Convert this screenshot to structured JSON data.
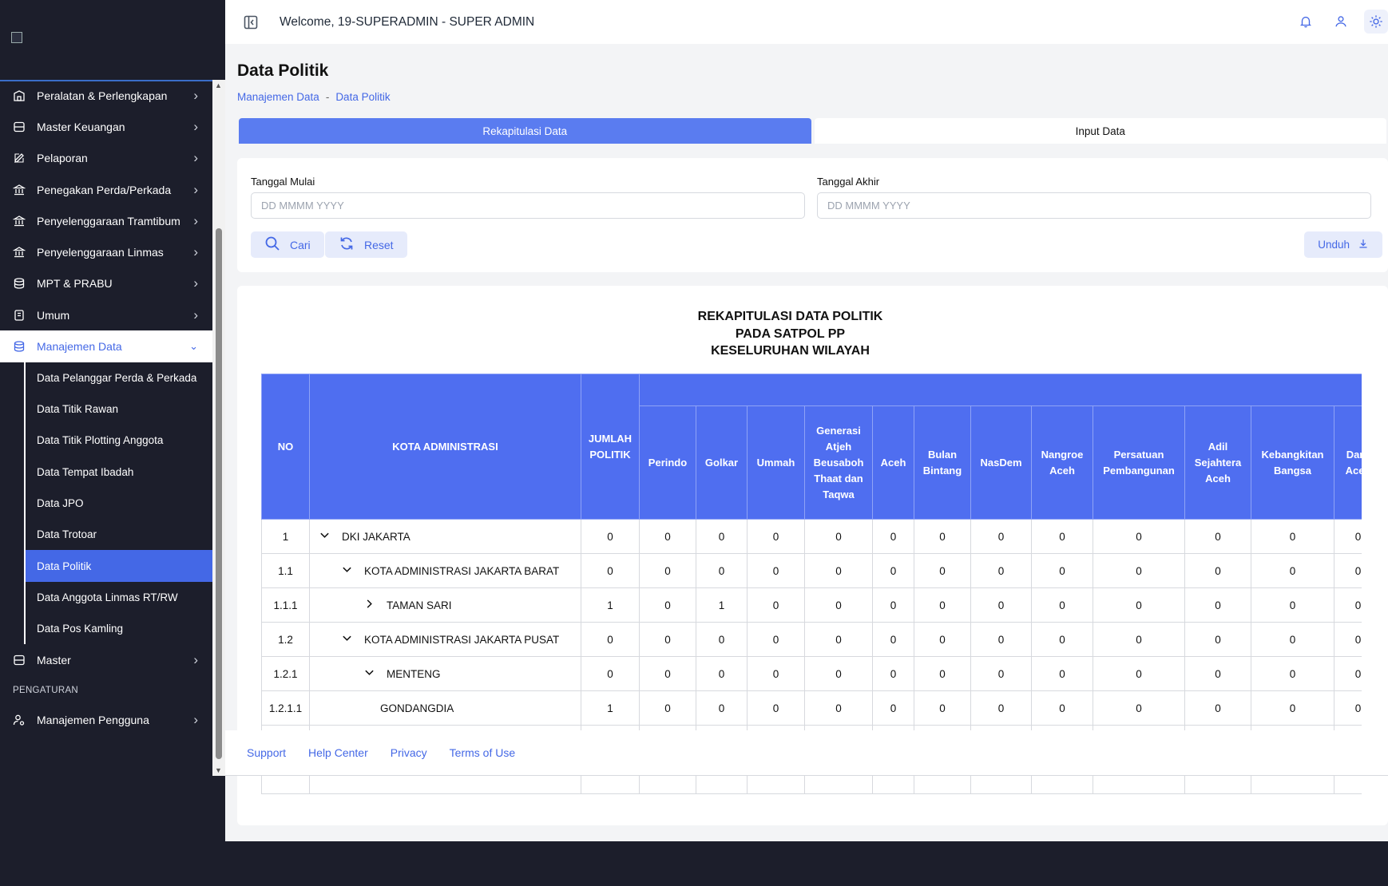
{
  "header": {
    "welcome": "Welcome, 19-SUPERADMIN - SUPER ADMIN",
    "icons": [
      "sidebar-toggle-icon",
      "bell-icon",
      "user-icon",
      "sun-icon"
    ]
  },
  "sidebar": {
    "items": [
      {
        "label": "Peralatan & Perlengkapan",
        "icon": "building-icon"
      },
      {
        "label": "Master Keuangan",
        "icon": "database-icon"
      },
      {
        "label": "Pelaporan",
        "icon": "edit-icon"
      },
      {
        "label": "Penegakan Perda/Perkada",
        "icon": "bank-icon"
      },
      {
        "label": "Penyelenggaraan Tramtibum",
        "icon": "bank-icon"
      },
      {
        "label": "Penyelenggaraan Linmas",
        "icon": "bank-icon"
      },
      {
        "label": "MPT & PRABU",
        "icon": "stack-icon"
      },
      {
        "label": "Umum",
        "icon": "book-icon"
      },
      {
        "label": "Manajemen Data",
        "icon": "stack-icon"
      }
    ],
    "subitems": [
      "Data Pelanggar Perda & Perkada",
      "Data Titik Rawan",
      "Data Titik Plotting Anggota",
      "Data Tempat Ibadah",
      "Data JPO",
      "Data Trotoar",
      "Data Politik",
      "Data Anggota Linmas RT/RW",
      "Data Pos Kamling"
    ],
    "after": {
      "label": "Master",
      "icon": "database-icon"
    },
    "section": "PENGATURAN",
    "settings": {
      "label": "Manajemen Pengguna",
      "icon": "user-cog-icon"
    }
  },
  "page": {
    "title": "Data Politik",
    "breadcrumb": [
      "Manajemen Data",
      "Data Politik"
    ],
    "breadcrumb_sep": "-"
  },
  "tabs": [
    "Rekapitulasi Data",
    "Input Data"
  ],
  "filter": {
    "start_label": "Tanggal Mulai",
    "start_placeholder": "DD MMMM YYYY",
    "end_label": "Tanggal Akhir",
    "end_placeholder": "DD MMMM YYYY",
    "search_btn": "Cari",
    "reset_btn": "Reset",
    "download_btn": "Unduh"
  },
  "report": {
    "title_lines": [
      "REKAPITULASI DATA POLITIK",
      "PADA SATPOL PP",
      "KESELURUHAN WILAYAH"
    ],
    "columns": {
      "no": "NO",
      "kota": "KOTA ADMINISTRASI",
      "jumlah": "JUMLAH POLITIK",
      "parties": [
        "Perindo",
        "Golkar",
        "Ummah",
        "Generasi Atjeh Beusaboh Thaat dan Taqwa",
        "Aceh",
        "Bulan Bintang",
        "NasDem",
        "Nangroe Aceh",
        "Persatuan Pembangunan",
        "Adil Sejahtera Aceh",
        "Kebangkitan Bangsa",
        "Daru Aceh"
      ]
    },
    "rows": [
      {
        "no": "1",
        "name": "DKI JAKARTA",
        "level": 0,
        "caret": "down",
        "values": [
          0,
          0,
          0,
          0,
          0,
          0,
          0,
          0,
          0,
          0,
          0,
          0,
          0
        ]
      },
      {
        "no": "1.1",
        "name": "KOTA ADMINISTRASI JAKARTA BARAT",
        "level": 1,
        "caret": "down",
        "values": [
          0,
          0,
          0,
          0,
          0,
          0,
          0,
          0,
          0,
          0,
          0,
          0,
          0
        ]
      },
      {
        "no": "1.1.1",
        "name": "TAMAN SARI",
        "level": 2,
        "caret": "right",
        "values": [
          1,
          0,
          1,
          0,
          0,
          0,
          0,
          0,
          0,
          0,
          0,
          0,
          0
        ]
      },
      {
        "no": "1.2",
        "name": "KOTA ADMINISTRASI JAKARTA PUSAT",
        "level": 1,
        "caret": "down",
        "values": [
          0,
          0,
          0,
          0,
          0,
          0,
          0,
          0,
          0,
          0,
          0,
          0,
          0
        ]
      },
      {
        "no": "1.2.1",
        "name": "MENTENG",
        "level": 2,
        "caret": "down",
        "values": [
          0,
          0,
          0,
          0,
          0,
          0,
          0,
          0,
          0,
          0,
          0,
          0,
          0
        ]
      },
      {
        "no": "1.2.1.1",
        "name": "GONDANGDIA",
        "level": 3,
        "caret": "none",
        "values": [
          1,
          0,
          0,
          0,
          0,
          0,
          0,
          0,
          0,
          0,
          0,
          0,
          0
        ]
      }
    ]
  },
  "footer": {
    "links": [
      "Support",
      "Help Center",
      "Privacy",
      "Terms of Use"
    ]
  },
  "colors": {
    "accent": "#4468e6",
    "sidebar_bg": "#1c1e2b",
    "header_table": "#4f6ef0"
  }
}
